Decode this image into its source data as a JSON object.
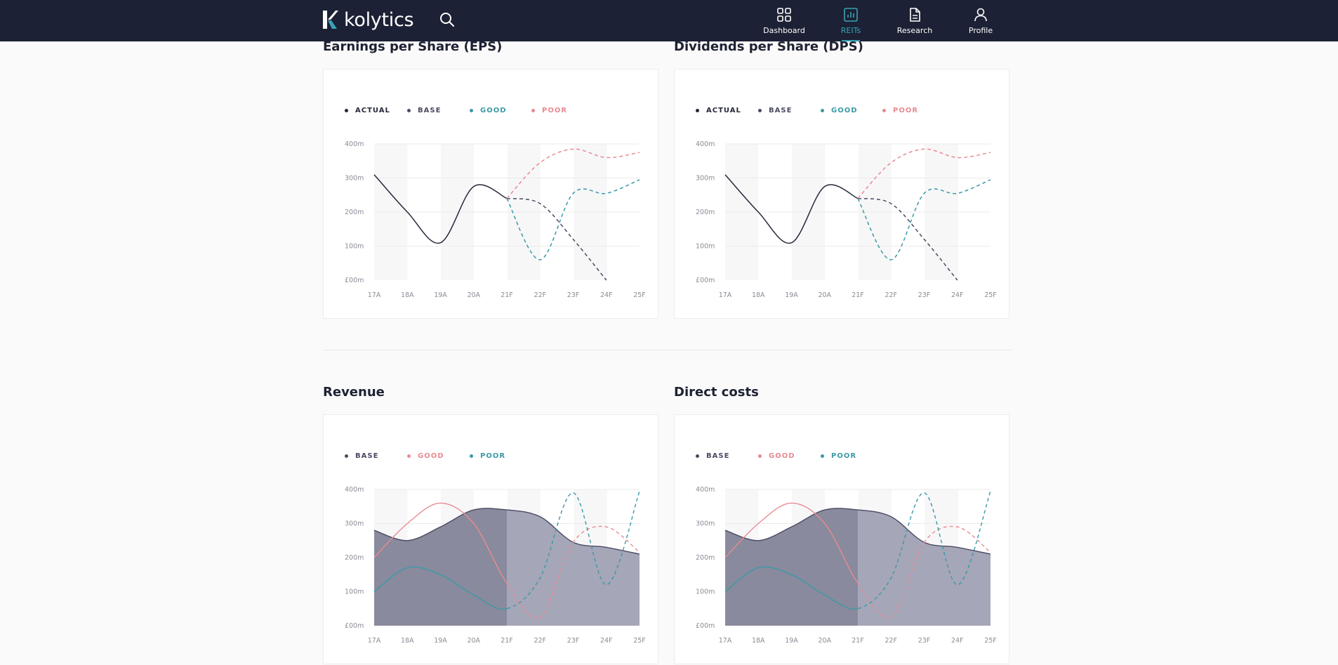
{
  "brand": {
    "name": "kolytics"
  },
  "nav": {
    "items": [
      {
        "label": "Dashboard",
        "icon": "grid-icon",
        "active": false
      },
      {
        "label": "REITs",
        "icon": "bar-chart-icon",
        "active": true
      },
      {
        "label": "Research",
        "icon": "document-icon",
        "active": false
      },
      {
        "label": "Profile",
        "icon": "user-icon",
        "active": false
      }
    ]
  },
  "colors": {
    "nav_bg": "#1c2135",
    "accent": "#38a3b4",
    "actual": "#252738",
    "base": "#4a4a63",
    "good": "#3b9aa6",
    "poor": "#e98a91"
  },
  "sections": [
    {
      "title": "Earnings per Share (EPS)",
      "legend": [
        {
          "label": "ACTUAL",
          "color": "#252738"
        },
        {
          "label": "BASE",
          "color": "#4a4a63"
        },
        {
          "label": "GOOD",
          "color": "#3b9aa6"
        },
        {
          "label": "POOR",
          "color": "#e98a91"
        }
      ]
    },
    {
      "title": "Dividends per Share (DPS)",
      "legend": [
        {
          "label": "ACTUAL",
          "color": "#252738"
        },
        {
          "label": "BASE",
          "color": "#4a4a63"
        },
        {
          "label": "GOOD",
          "color": "#3b9aa6"
        },
        {
          "label": "POOR",
          "color": "#e98a91"
        }
      ]
    },
    {
      "title": "Revenue",
      "legend": [
        {
          "label": "BASE",
          "color": "#4a4a63"
        },
        {
          "label": "GOOD",
          "color": "#e98a91"
        },
        {
          "label": "POOR",
          "color": "#3b9aa6"
        }
      ]
    },
    {
      "title": "Direct costs",
      "legend": [
        {
          "label": "BASE",
          "color": "#4a4a63"
        },
        {
          "label": "GOOD",
          "color": "#e98a91"
        },
        {
          "label": "POOR",
          "color": "#3b9aa6"
        }
      ]
    }
  ],
  "chart_data": [
    {
      "type": "line",
      "title": "Earnings per Share (EPS)",
      "categories": [
        "17A",
        "18A",
        "19A",
        "20A",
        "21F",
        "22F",
        "23F",
        "24F",
        "25F"
      ],
      "yticks": [
        "£00m",
        "100m",
        "200m",
        "300m",
        "400m"
      ],
      "ylim": [
        0,
        400
      ],
      "series": [
        {
          "name": "ACTUAL",
          "color": "#252738",
          "dashed": false,
          "values": [
            310,
            200,
            110,
            275,
            240,
            null,
            null,
            null,
            null
          ]
        },
        {
          "name": "BASE",
          "color": "#4a4a63",
          "dashed": true,
          "values": [
            null,
            null,
            null,
            null,
            240,
            225,
            120,
            0,
            null
          ]
        },
        {
          "name": "GOOD",
          "color": "#3b9aa6",
          "dashed": true,
          "values": [
            null,
            null,
            null,
            null,
            240,
            60,
            255,
            255,
            295
          ]
        },
        {
          "name": "POOR",
          "color": "#e98a91",
          "dashed": true,
          "values": [
            null,
            null,
            null,
            null,
            240,
            345,
            385,
            360,
            375
          ]
        }
      ]
    },
    {
      "type": "line",
      "title": "Dividends per Share (DPS)",
      "categories": [
        "17A",
        "18A",
        "19A",
        "20A",
        "21F",
        "22F",
        "23F",
        "24F",
        "25F"
      ],
      "yticks": [
        "£00m",
        "100m",
        "200m",
        "300m",
        "400m"
      ],
      "ylim": [
        0,
        400
      ],
      "series": [
        {
          "name": "ACTUAL",
          "color": "#252738",
          "dashed": false,
          "values": [
            310,
            200,
            110,
            275,
            240,
            null,
            null,
            null,
            null
          ]
        },
        {
          "name": "BASE",
          "color": "#4a4a63",
          "dashed": true,
          "values": [
            null,
            null,
            null,
            null,
            240,
            225,
            120,
            0,
            null
          ]
        },
        {
          "name": "GOOD",
          "color": "#3b9aa6",
          "dashed": true,
          "values": [
            null,
            null,
            null,
            null,
            240,
            60,
            255,
            255,
            295
          ]
        },
        {
          "name": "POOR",
          "color": "#e98a91",
          "dashed": true,
          "values": [
            null,
            null,
            null,
            null,
            240,
            345,
            385,
            360,
            375
          ]
        }
      ]
    },
    {
      "type": "area",
      "title": "Revenue",
      "categories": [
        "17A",
        "18A",
        "19A",
        "20A",
        "21F",
        "22F",
        "23F",
        "24F",
        "25F"
      ],
      "yticks": [
        "£00m",
        "100m",
        "200m",
        "300m",
        "400m"
      ],
      "ylim": [
        0,
        400
      ],
      "actual_until": "21F",
      "series": [
        {
          "name": "BASE",
          "color": "#4a4a63",
          "fill": true,
          "values": [
            280,
            250,
            290,
            340,
            340,
            320,
            245,
            230,
            210
          ]
        },
        {
          "name": "GOOD",
          "color": "#e98a91",
          "fill": false,
          "values": [
            200,
            300,
            360,
            300,
            125,
            25,
            245,
            290,
            215
          ]
        },
        {
          "name": "POOR",
          "color": "#3b9aa6",
          "fill": false,
          "values": [
            100,
            170,
            150,
            90,
            50,
            140,
            390,
            120,
            395
          ]
        }
      ]
    },
    {
      "type": "area",
      "title": "Direct costs",
      "categories": [
        "17A",
        "18A",
        "19A",
        "20A",
        "21F",
        "22F",
        "23F",
        "24F",
        "25F"
      ],
      "yticks": [
        "£00m",
        "100m",
        "200m",
        "300m",
        "400m"
      ],
      "ylim": [
        0,
        400
      ],
      "actual_until": "21F",
      "series": [
        {
          "name": "BASE",
          "color": "#4a4a63",
          "fill": true,
          "values": [
            280,
            250,
            290,
            340,
            340,
            320,
            245,
            230,
            210
          ]
        },
        {
          "name": "GOOD",
          "color": "#e98a91",
          "fill": false,
          "values": [
            200,
            300,
            360,
            300,
            125,
            25,
            245,
            290,
            215
          ]
        },
        {
          "name": "POOR",
          "color": "#3b9aa6",
          "fill": false,
          "values": [
            100,
            170,
            150,
            90,
            50,
            140,
            390,
            120,
            395
          ]
        }
      ]
    }
  ]
}
